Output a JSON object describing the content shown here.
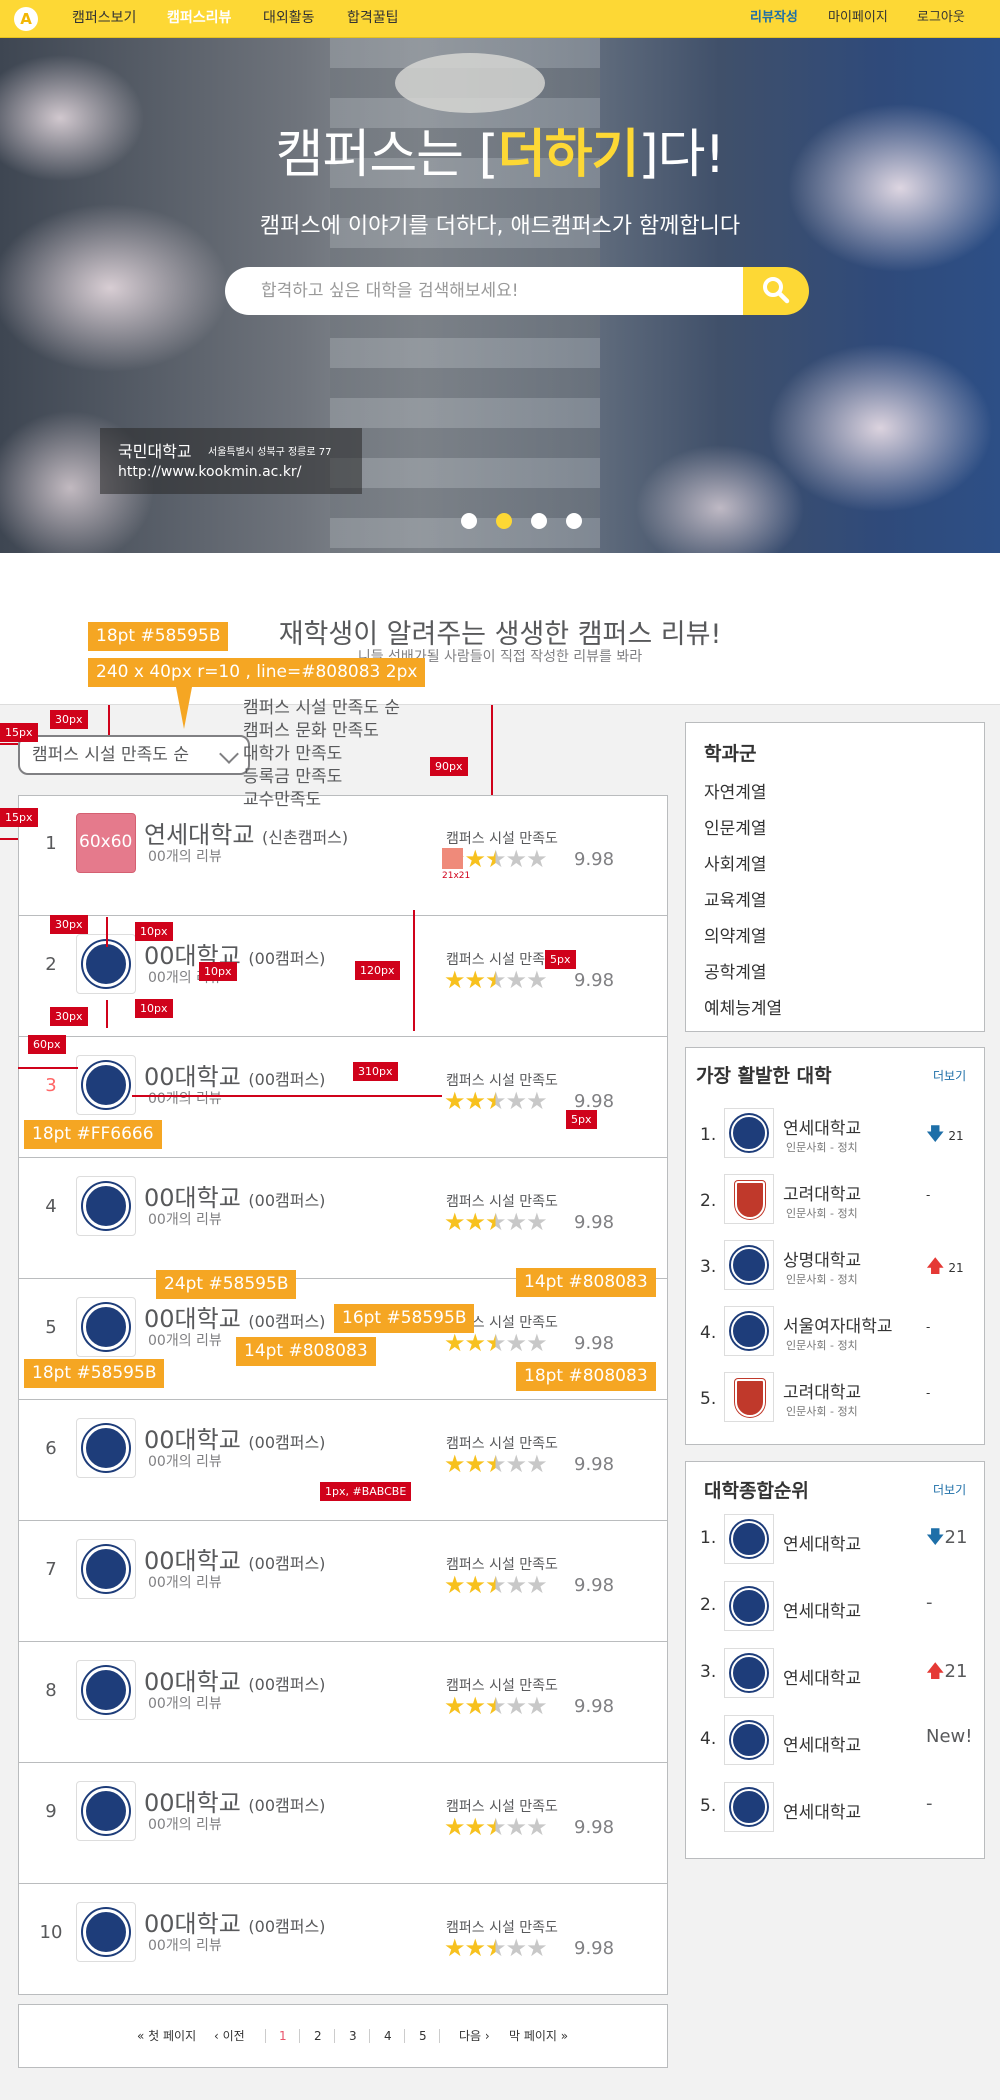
{
  "nav": {
    "logo": "A",
    "items": [
      "캠퍼스보기",
      "캠퍼스리뷰",
      "대외활동",
      "합격꿀팁"
    ],
    "right": [
      "리뷰작성",
      "마이페이지",
      "로그아웃"
    ]
  },
  "hero": {
    "title_pre": "캠퍼스는 [",
    "title_hl": "더하기",
    "title_post": "]다!",
    "subtitle": "캠퍼스에 이야기를 더하다, 애드캠퍼스가 함께합니다",
    "search_placeholder": "합격하고 싶은 대학을 검색해보세요!",
    "campus_name": "국민대학교",
    "campus_addr": "서울특별시 성북구 정릉로 77",
    "campus_url": "http://www.kookmin.ac.kr/"
  },
  "section": {
    "title": "재학생이 알려주는 생생한 캠퍼스 리뷰!",
    "subtitle": "니들 선배가될 사람들이 직접 작성한 리뷰를 봐라"
  },
  "annotations": {
    "a1": "18pt   #58595B",
    "a2": "240 x 40px r=10 , line=#808083 2px",
    "a3": "24pt   #58595B",
    "a4": "14pt   #808083",
    "a5": "16pt   #58595B",
    "a6": "14pt   #808083",
    "a7": "18pt   #58595B",
    "a8": "18pt   #808083",
    "a9": "18pt   #FF6666",
    "r15a": "15px",
    "r30a": "30px",
    "r90": "90px",
    "r15b": "15px",
    "r30b": "30px",
    "r10a": "10px",
    "r10b": "10px",
    "r10c": "10px",
    "r120": "120px",
    "r5a": "5px",
    "r30c": "30px",
    "r60": "60px",
    "r310": "310px",
    "r5b": "5px",
    "r1px": "1px, #BABCBE",
    "logo_size": "60x60",
    "star_size": "21x21"
  },
  "sort": {
    "selected": "캠퍼스 시설 만족도 순",
    "options": [
      "캠퍼스 시설 만족도 순",
      "캠퍼스 문화 만족도",
      "대학가 만족도",
      "등록금 만족도",
      "교수만족도"
    ]
  },
  "list": [
    {
      "rank": "1",
      "name": "연세대학교",
      "campus": "(신촌캠퍼스)",
      "reviews": "00개의 리뷰",
      "metric": "캠퍼스 시설 만족도",
      "rating": 2.5,
      "score": "9.98"
    },
    {
      "rank": "2",
      "name": "00대학교",
      "campus": "(00캠퍼스)",
      "reviews": "00개의 리뷰",
      "metric": "캠퍼스 시설 만족도",
      "rating": 2.5,
      "score": "9.98"
    },
    {
      "rank": "3",
      "name": "00대학교",
      "campus": "(00캠퍼스)",
      "reviews": "00개의 리뷰",
      "metric": "캠퍼스 시설 만족도",
      "rating": 2.5,
      "score": "9.98"
    },
    {
      "rank": "4",
      "name": "00대학교",
      "campus": "(00캠퍼스)",
      "reviews": "00개의 리뷰",
      "metric": "캠퍼스 시설 만족도",
      "rating": 2.5,
      "score": "9.98"
    },
    {
      "rank": "5",
      "name": "00대학교",
      "campus": "(00캠퍼스)",
      "reviews": "00개의 리뷰",
      "metric": "캠퍼스 시설 만족도",
      "rating": 2.5,
      "score": "9.98"
    },
    {
      "rank": "6",
      "name": "00대학교",
      "campus": "(00캠퍼스)",
      "reviews": "00개의 리뷰",
      "metric": "캠퍼스 시설 만족도",
      "rating": 2.5,
      "score": "9.98"
    },
    {
      "rank": "7",
      "name": "00대학교",
      "campus": "(00캠퍼스)",
      "reviews": "00개의 리뷰",
      "metric": "캠퍼스 시설 만족도",
      "rating": 2.5,
      "score": "9.98"
    },
    {
      "rank": "8",
      "name": "00대학교",
      "campus": "(00캠퍼스)",
      "reviews": "00개의 리뷰",
      "metric": "캠퍼스 시설 만족도",
      "rating": 2.5,
      "score": "9.98"
    },
    {
      "rank": "9",
      "name": "00대학교",
      "campus": "(00캠퍼스)",
      "reviews": "00개의 리뷰",
      "metric": "캠퍼스 시설 만족도",
      "rating": 2.5,
      "score": "9.98"
    },
    {
      "rank": "10",
      "name": "00대학교",
      "campus": "(00캠퍼스)",
      "reviews": "00개의 리뷰",
      "metric": "캠퍼스 시설 만족도",
      "rating": 2.5,
      "score": "9.98"
    }
  ],
  "pager": {
    "first": "첫 페이지",
    "prev": "이전",
    "pages": [
      "1",
      "2",
      "3",
      "4",
      "5"
    ],
    "current": "1",
    "next": "다음",
    "last": "막 페이지"
  },
  "sidebar": {
    "categories": {
      "title": "학과군",
      "items": [
        "자연계열",
        "인문계열",
        "사회계열",
        "교육계열",
        "의약계열",
        "공학계열",
        "예체능계열"
      ]
    },
    "active": {
      "title": "가장 활발한 대학",
      "more": "더보기",
      "items": [
        {
          "rank": "1.",
          "name": "연세대학교",
          "dept": "인문사회 - 정치",
          "trend": "down",
          "value": "21"
        },
        {
          "rank": "2.",
          "name": "고려대학교",
          "dept": "인문사회 - 정치",
          "trend": "same",
          "value": "-"
        },
        {
          "rank": "3.",
          "name": "상명대학교",
          "dept": "인문사회 - 정치",
          "trend": "up",
          "value": "21"
        },
        {
          "rank": "4.",
          "name": "서울여자대학교",
          "dept": "인문사회 - 정치",
          "trend": "same",
          "value": "-"
        },
        {
          "rank": "5.",
          "name": "고려대학교",
          "dept": "인문사회 - 정치",
          "trend": "same",
          "value": "-"
        }
      ]
    },
    "overall": {
      "title": "대학종합순위",
      "more": "더보기",
      "items": [
        {
          "rank": "1.",
          "name": "연세대학교",
          "trend": "down",
          "value": "21"
        },
        {
          "rank": "2.",
          "name": "연세대학교",
          "trend": "same",
          "value": "-"
        },
        {
          "rank": "3.",
          "name": "연세대학교",
          "trend": "up",
          "value": "21"
        },
        {
          "rank": "4.",
          "name": "연세대학교",
          "trend": "new",
          "value": "New!"
        },
        {
          "rank": "5.",
          "name": "연세대학교",
          "trend": "same",
          "value": "-"
        }
      ]
    }
  },
  "colors": {
    "brand": "#fdd835",
    "text": "#58595b",
    "muted": "#808083",
    "border": "#babcbe",
    "hot": "#ff6666",
    "link": "#1e6fa8"
  }
}
